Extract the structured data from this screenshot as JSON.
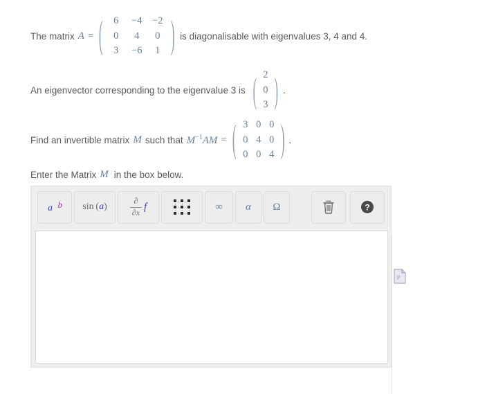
{
  "problem": {
    "line1": {
      "prefix": "The matrix",
      "symbol": "A",
      "equals": "=",
      "matrix": [
        [
          "6",
          "−4",
          "−2"
        ],
        [
          "0",
          "4",
          "0"
        ],
        [
          "3",
          "−6",
          "1"
        ]
      ],
      "suffix": "is diagonalisable with eigenvalues 3, 4 and 4."
    },
    "line2": {
      "prefix": "An eigenvector corresponding to the eigenvalue 3 is",
      "vector": [
        "2",
        "0",
        "3"
      ],
      "suffix": "."
    },
    "line3": {
      "prefix": "Find an invertible matrix",
      "symbol": "M",
      "expr_before": "such that",
      "expr": "M−1AM",
      "expr_m": "M",
      "expr_sup": "−1",
      "expr_rest": "AM",
      "equals": "=",
      "matrix": [
        [
          "3",
          "0",
          "0"
        ],
        [
          "0",
          "4",
          "0"
        ],
        [
          "0",
          "0",
          "4"
        ]
      ],
      "suffix": "."
    },
    "line4": {
      "prefix": "Enter the Matrix",
      "symbol": "M",
      "suffix": "in the box below."
    }
  },
  "editor": {
    "toolbar": {
      "left_buttons": [
        {
          "name": "exponent-button",
          "label": "a^b",
          "base": "a",
          "exp": "b"
        },
        {
          "name": "sine-button",
          "label": "sin(a)",
          "fn": "sin (",
          "arg": "a",
          "close": ")"
        },
        {
          "name": "derivative-button",
          "label": "∂/∂x f",
          "num": "∂",
          "den": "∂x",
          "fn": "f"
        },
        {
          "name": "matrix-button",
          "label": "matrix"
        },
        {
          "name": "infinity-button",
          "label": "∞"
        },
        {
          "name": "alpha-button",
          "label": "α"
        },
        {
          "name": "omega-button",
          "label": "Ω"
        }
      ],
      "right_buttons": [
        {
          "name": "clear-button",
          "label": "trash"
        },
        {
          "name": "help-button",
          "label": "?"
        }
      ]
    },
    "input": {
      "value": "",
      "placeholder": ""
    }
  },
  "side": {
    "doc_icon_label": "document"
  },
  "colors": {
    "math": "#69809c",
    "prose": "#5a5a5a",
    "toolbar_bg": "#eeeeee",
    "button_bg": "#ededed",
    "button_border": "#dcdcdc",
    "input_bg": "#ffffff",
    "accent_blue": "#3a3ad0",
    "accent_purple": "#8a2fa8"
  }
}
